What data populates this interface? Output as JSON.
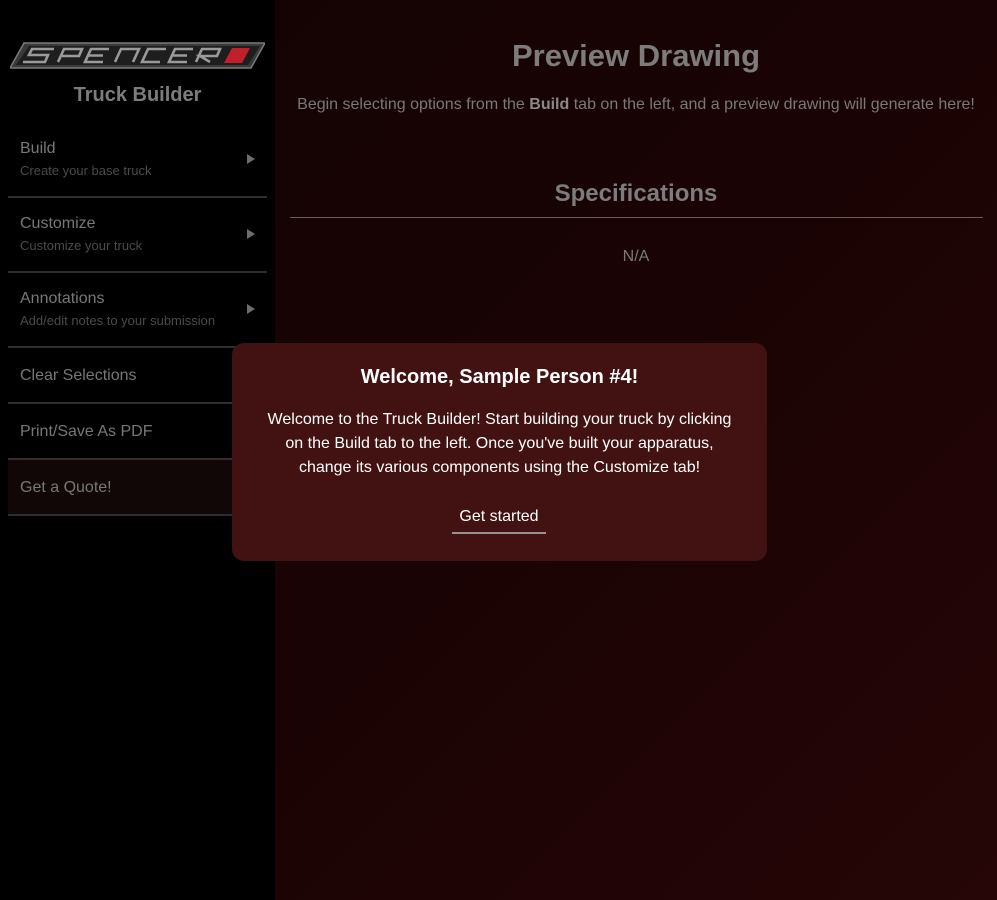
{
  "brand": {
    "logo_icon": "spencer-logo-icon",
    "app_title": "Truck Builder"
  },
  "sidebar": {
    "items": [
      {
        "label": "Build",
        "sublabel": "Create your base truck",
        "icon": "chevron-right-icon"
      },
      {
        "label": "Customize",
        "sublabel": "Customize your truck",
        "icon": "chevron-right-icon"
      },
      {
        "label": "Annotations",
        "sublabel": "Add/edit notes to your submission",
        "icon": "chevron-right-icon"
      },
      {
        "label": "Clear Selections"
      },
      {
        "label": "Print/Save As PDF"
      },
      {
        "label": "Get a Quote!"
      }
    ]
  },
  "main": {
    "title": "Preview Drawing",
    "intro_before": "Begin selecting options from the ",
    "intro_bold": "Build",
    "intro_after": " tab on the left, and a preview drawing will generate here!",
    "specs_title": "Specifications",
    "specs_value": "N/A"
  },
  "modal": {
    "title": "Welcome, Sample Person #4!",
    "body": "Welcome to the Truck Builder! Start building your truck by clicking on the Build tab to the left. Once you've built your apparatus, change its various components using the Customize tab!",
    "button": "Get started"
  },
  "colors": {
    "modal_background": "#421212",
    "sidebar_background": "#000000",
    "accent_red": "#c0202a"
  }
}
